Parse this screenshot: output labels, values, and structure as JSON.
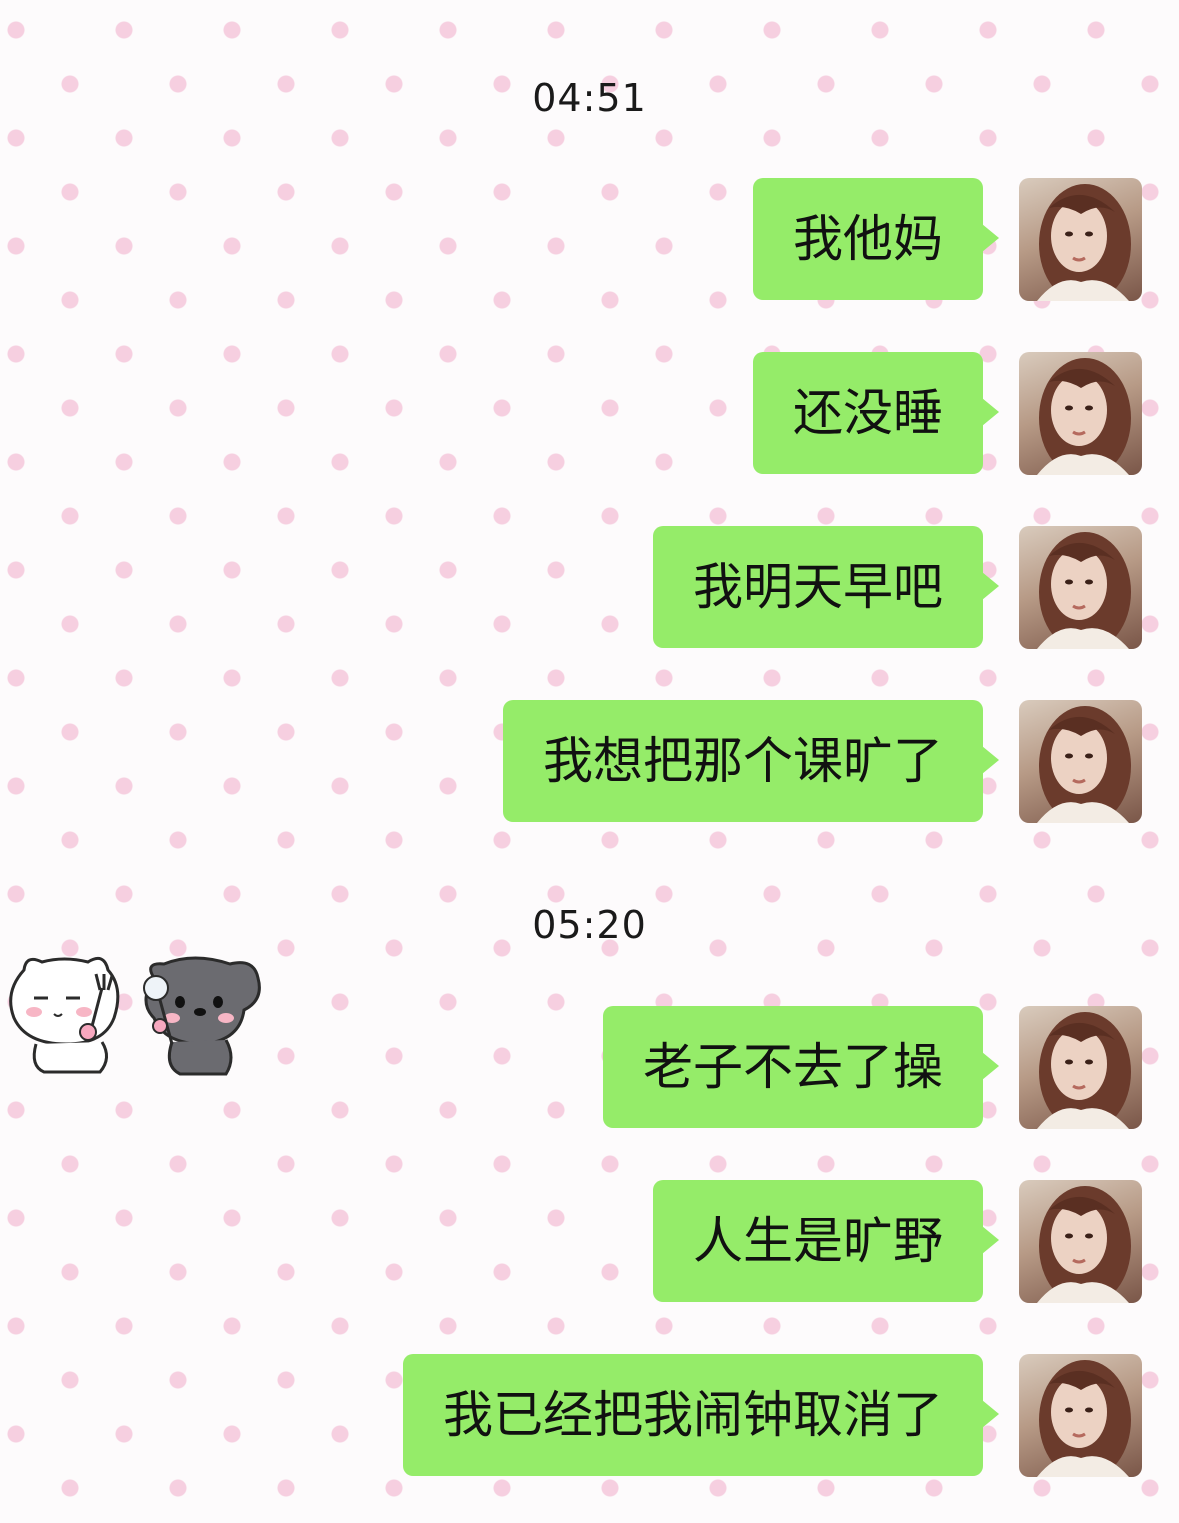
{
  "chat": {
    "timestamps": [
      "04:51",
      "05:20"
    ],
    "messages": [
      {
        "text": "我他妈",
        "sender": "self"
      },
      {
        "text": "还没睡",
        "sender": "self"
      },
      {
        "text": "我明天早吧",
        "sender": "self"
      },
      {
        "text": "我想把那个课旷了",
        "sender": "self"
      },
      {
        "text": "老子不去了操",
        "sender": "self"
      },
      {
        "text": "人生是旷野",
        "sender": "self"
      },
      {
        "text": "我已经把我闹钟取消了",
        "sender": "self"
      }
    ]
  },
  "colors": {
    "bubble_self": "#95ec69",
    "background": "#fdfbfc",
    "dot": "#f6cfe0"
  },
  "icons": {
    "avatar": "user-avatar-photo",
    "sticker": "cat-and-dog-sticker"
  }
}
